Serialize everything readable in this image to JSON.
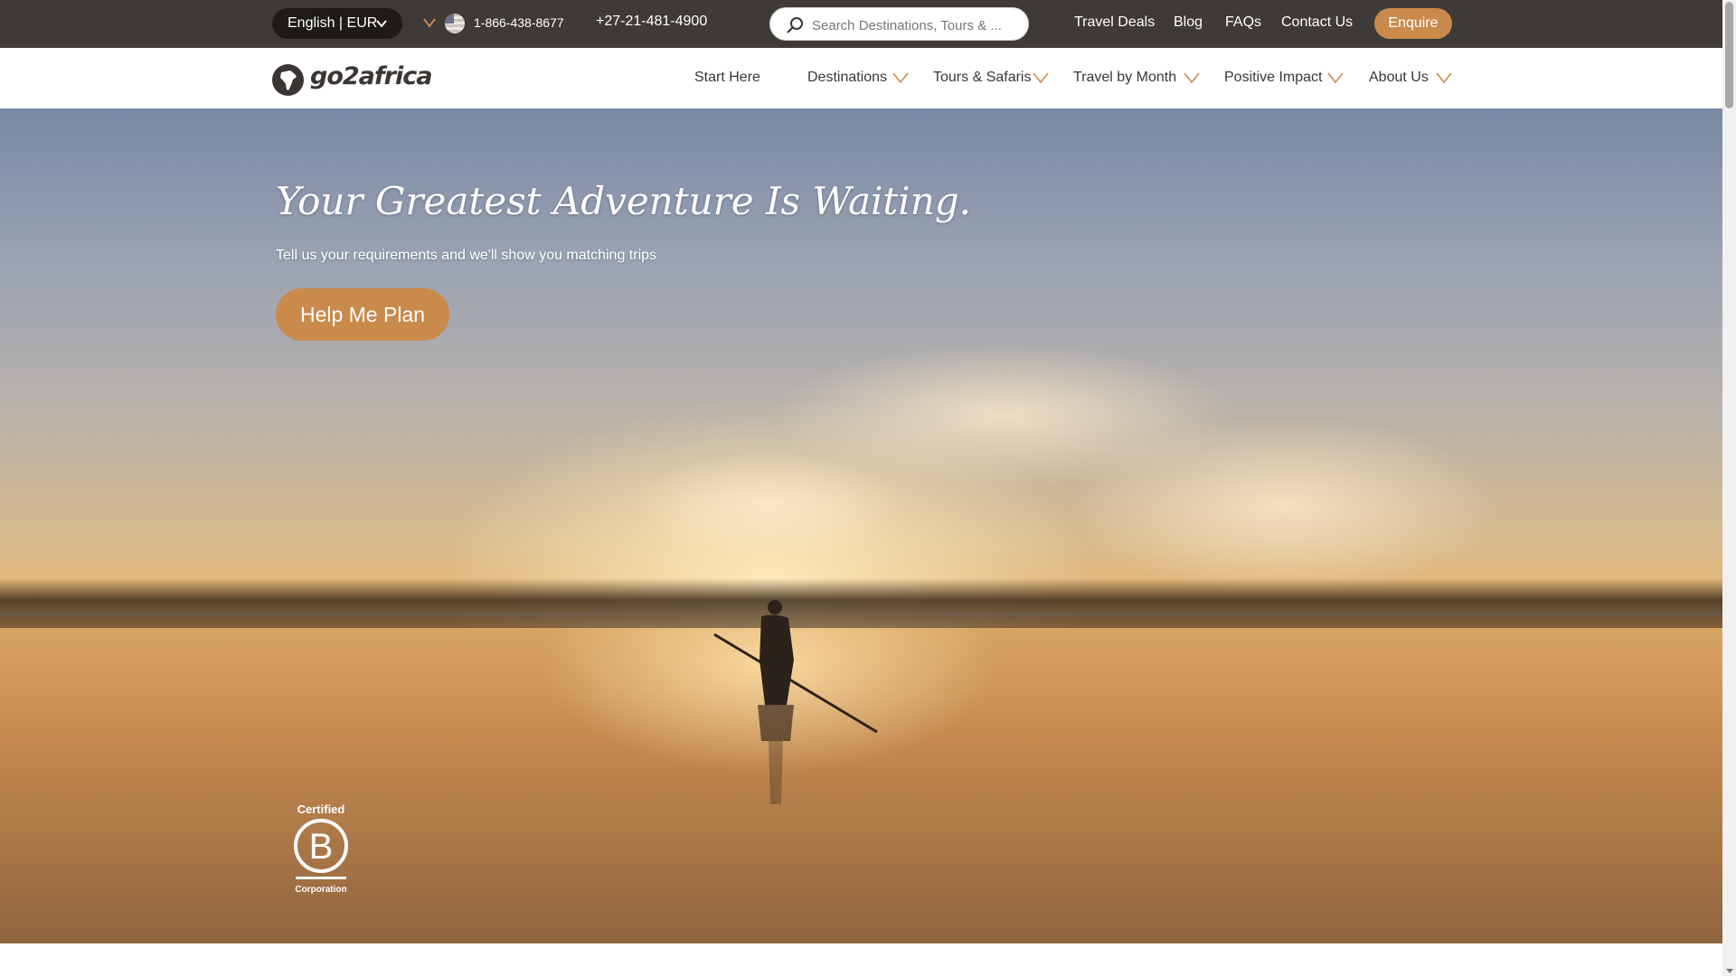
{
  "topbar": {
    "language_currency": "English | EUR",
    "phone_us": "1-866-438-8677",
    "phone_intl": "+27-21-481-4900",
    "search_placeholder": "Search Destinations, Tours & ...",
    "links": [
      "Travel Deals",
      "Blog",
      "FAQs",
      "Contact Us"
    ],
    "enquire_label": "Enquire"
  },
  "nav": {
    "logo_text": "go2africa",
    "items": [
      {
        "label": "Start Here",
        "has_dropdown": false
      },
      {
        "label": "Destinations",
        "has_dropdown": true
      },
      {
        "label": "Tours & Safaris",
        "has_dropdown": true
      },
      {
        "label": "Travel by Month",
        "has_dropdown": true
      },
      {
        "label": "Positive Impact",
        "has_dropdown": true
      },
      {
        "label": "About Us",
        "has_dropdown": true
      }
    ]
  },
  "hero": {
    "title": "Your Greatest Adventure Is Waiting.",
    "subtitle": "Tell us your requirements and we'll show you matching trips",
    "cta_label": "Help Me Plan",
    "badge": {
      "line1": "Certified",
      "letter": "B",
      "line2": "Corporation"
    }
  },
  "colors": {
    "accent": "#c98a4b",
    "topbar": "#3e3a37",
    "text_dark": "#3b3633"
  }
}
